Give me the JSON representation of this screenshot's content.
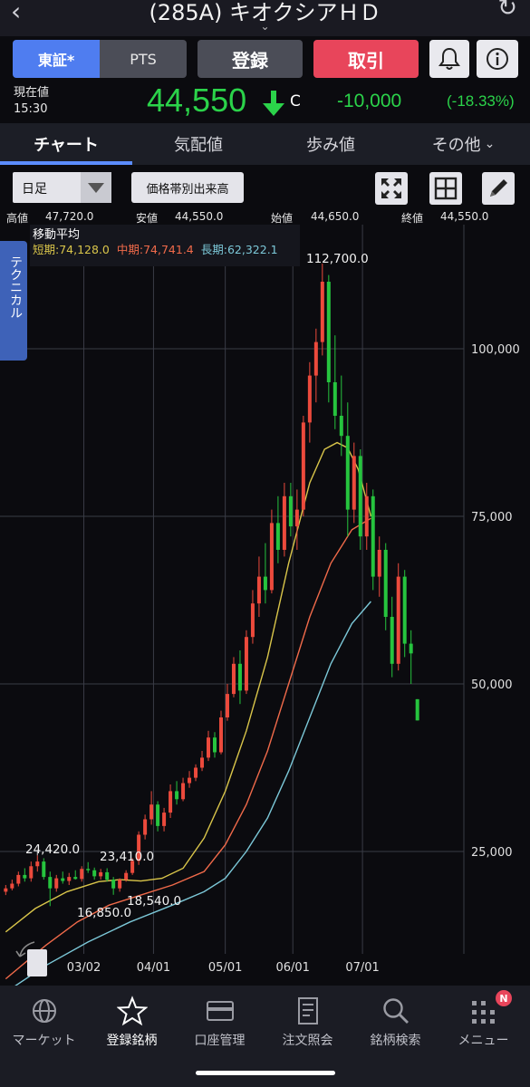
{
  "header": {
    "title": "(285A) キオクシアＨＤ"
  },
  "buttons": {
    "market_tse": "東証*",
    "market_pts": "PTS",
    "register": "登録",
    "trade": "取引"
  },
  "price": {
    "label": "現在値",
    "time": "15:30",
    "value": "44,550",
    "marker": "C",
    "change": "-10,000",
    "change_pct": "(-18.33%)"
  },
  "tabs": [
    {
      "label": "チャート"
    },
    {
      "label": "気配値"
    },
    {
      "label": "歩み値"
    },
    {
      "label": "その他"
    }
  ],
  "toolbar": {
    "period": "日足",
    "vol_by_price": "価格帯別出来高"
  },
  "ohlc": {
    "high_label": "高値",
    "high": "47,720.0",
    "low_label": "安値",
    "low": "44,550.0",
    "open_label": "始値",
    "open": "44,650.0",
    "close_label": "終値",
    "close": "44,550.0"
  },
  "ma": {
    "title": "移動平均",
    "short": "短期:74,128.0",
    "mid": "中期:74,741.4",
    "long": "長期:62,322.1"
  },
  "side_tab": "テクニカル",
  "colors": {
    "up": "#ec4a3c",
    "down": "#26c43e",
    "ma_short": "#d9c54a",
    "ma_mid": "#f06a4a",
    "ma_long": "#7cc8d8",
    "accent": "#4f7df0"
  },
  "chart_data": {
    "type": "candlestick",
    "yticks": [
      "25,000",
      "50,000",
      "75,000",
      "100,000"
    ],
    "ytick_values": [
      25000,
      50000,
      75000,
      100000
    ],
    "xticks": [
      "03/02",
      "04/01",
      "05/01",
      "06/01",
      "07/01"
    ],
    "annotations": [
      {
        "text": "112,700.0",
        "kind": "high"
      },
      {
        "text": "24,420.0",
        "kind": "local_high"
      },
      {
        "text": "23,410.0",
        "kind": "local_high"
      },
      {
        "text": "16,850.0",
        "kind": "local_low"
      },
      {
        "text": "18,540.0",
        "kind": "local_low"
      }
    ],
    "series": [
      {
        "name": "短期",
        "type": "line",
        "points": [
          [
            1,
            13000
          ],
          [
            15,
            16500
          ],
          [
            30,
            19000
          ],
          [
            45,
            20500
          ],
          [
            55,
            20800
          ],
          [
            65,
            20600
          ],
          [
            75,
            21000
          ],
          [
            85,
            22500
          ],
          [
            95,
            27000
          ],
          [
            105,
            34000
          ],
          [
            115,
            43000
          ],
          [
            125,
            54000
          ],
          [
            135,
            68000
          ],
          [
            145,
            80000
          ],
          [
            152,
            85000
          ],
          [
            158,
            86000
          ],
          [
            163,
            85200
          ],
          [
            168,
            82000
          ],
          [
            174,
            75000
          ]
        ]
      },
      {
        "name": "中期",
        "type": "line",
        "points": [
          [
            1,
            6000
          ],
          [
            20,
            11000
          ],
          [
            35,
            14500
          ],
          [
            50,
            17000
          ],
          [
            65,
            18500
          ],
          [
            80,
            20000
          ],
          [
            95,
            22000
          ],
          [
            105,
            26000
          ],
          [
            115,
            32000
          ],
          [
            125,
            40000
          ],
          [
            135,
            50000
          ],
          [
            145,
            60000
          ],
          [
            155,
            68000
          ],
          [
            165,
            73000
          ],
          [
            174,
            74700
          ]
        ]
      },
      {
        "name": "長期",
        "type": "line",
        "points": [
          [
            1,
            4000
          ],
          [
            20,
            8000
          ],
          [
            40,
            11500
          ],
          [
            60,
            14500
          ],
          [
            80,
            17000
          ],
          [
            95,
            19000
          ],
          [
            105,
            21000
          ],
          [
            115,
            25000
          ],
          [
            125,
            30000
          ],
          [
            135,
            37000
          ],
          [
            145,
            45000
          ],
          [
            155,
            53000
          ],
          [
            165,
            59000
          ],
          [
            174,
            62300
          ]
        ]
      }
    ],
    "candles": [
      {
        "i": 1,
        "o": 19000,
        "h": 20000,
        "l": 18500,
        "c": 19500
      },
      {
        "i": 4,
        "o": 19500,
        "h": 20800,
        "l": 19200,
        "c": 20200
      },
      {
        "i": 7,
        "o": 20200,
        "h": 22000,
        "l": 19800,
        "c": 21500
      },
      {
        "i": 10,
        "o": 21500,
        "h": 22500,
        "l": 20500,
        "c": 21000
      },
      {
        "i": 13,
        "o": 21000,
        "h": 23500,
        "l": 20500,
        "c": 22800
      },
      {
        "i": 16,
        "o": 22800,
        "h": 24420,
        "l": 22000,
        "c": 23500
      },
      {
        "i": 19,
        "o": 23500,
        "h": 24000,
        "l": 20800,
        "c": 21200
      },
      {
        "i": 22,
        "o": 21200,
        "h": 22000,
        "l": 16850,
        "c": 19500
      },
      {
        "i": 25,
        "o": 19500,
        "h": 21500,
        "l": 19000,
        "c": 21000
      },
      {
        "i": 28,
        "o": 21000,
        "h": 22000,
        "l": 20200,
        "c": 20600
      },
      {
        "i": 31,
        "o": 20600,
        "h": 21800,
        "l": 20000,
        "c": 21200
      },
      {
        "i": 34,
        "o": 21200,
        "h": 22200,
        "l": 20800,
        "c": 20900
      },
      {
        "i": 37,
        "o": 20900,
        "h": 22800,
        "l": 20500,
        "c": 22400
      },
      {
        "i": 40,
        "o": 22400,
        "h": 23410,
        "l": 21800,
        "c": 22200
      },
      {
        "i": 43,
        "o": 22200,
        "h": 22600,
        "l": 20800,
        "c": 21300
      },
      {
        "i": 46,
        "o": 21300,
        "h": 22400,
        "l": 20800,
        "c": 21900
      },
      {
        "i": 49,
        "o": 21900,
        "h": 22500,
        "l": 20500,
        "c": 20800
      },
      {
        "i": 52,
        "o": 20800,
        "h": 21200,
        "l": 18540,
        "c": 19500
      },
      {
        "i": 55,
        "o": 19500,
        "h": 21000,
        "l": 19000,
        "c": 20800
      },
      {
        "i": 58,
        "o": 20800,
        "h": 22200,
        "l": 20500,
        "c": 21800
      },
      {
        "i": 61,
        "o": 21800,
        "h": 24000,
        "l": 21500,
        "c": 23600
      },
      {
        "i": 64,
        "o": 23600,
        "h": 28000,
        "l": 23000,
        "c": 27500
      },
      {
        "i": 67,
        "o": 27500,
        "h": 30500,
        "l": 26800,
        "c": 29800
      },
      {
        "i": 70,
        "o": 29800,
        "h": 34000,
        "l": 29000,
        "c": 32000
      },
      {
        "i": 73,
        "o": 32000,
        "h": 32500,
        "l": 28000,
        "c": 28800
      },
      {
        "i": 76,
        "o": 28800,
        "h": 31500,
        "l": 28000,
        "c": 30800
      },
      {
        "i": 79,
        "o": 30800,
        "h": 35000,
        "l": 30000,
        "c": 34000
      },
      {
        "i": 82,
        "o": 34000,
        "h": 35500,
        "l": 32000,
        "c": 32800
      },
      {
        "i": 85,
        "o": 32800,
        "h": 36000,
        "l": 32500,
        "c": 35200
      },
      {
        "i": 88,
        "o": 35200,
        "h": 37000,
        "l": 34500,
        "c": 36000
      },
      {
        "i": 91,
        "o": 36000,
        "h": 38000,
        "l": 35500,
        "c": 37500
      },
      {
        "i": 94,
        "o": 37500,
        "h": 40000,
        "l": 37000,
        "c": 39000
      },
      {
        "i": 97,
        "o": 39000,
        "h": 43000,
        "l": 38500,
        "c": 42000
      },
      {
        "i": 100,
        "o": 42000,
        "h": 42800,
        "l": 39000,
        "c": 39800
      },
      {
        "i": 103,
        "o": 39800,
        "h": 46000,
        "l": 39500,
        "c": 45000
      },
      {
        "i": 106,
        "o": 45000,
        "h": 50000,
        "l": 44500,
        "c": 48500
      },
      {
        "i": 109,
        "o": 48500,
        "h": 54000,
        "l": 48000,
        "c": 53000
      },
      {
        "i": 112,
        "o": 53000,
        "h": 55000,
        "l": 47000,
        "c": 49000
      },
      {
        "i": 115,
        "o": 49000,
        "h": 58000,
        "l": 48500,
        "c": 57000
      },
      {
        "i": 118,
        "o": 57000,
        "h": 64000,
        "l": 56000,
        "c": 62000
      },
      {
        "i": 121,
        "o": 62000,
        "h": 69000,
        "l": 60000,
        "c": 66000
      },
      {
        "i": 124,
        "o": 66000,
        "h": 71000,
        "l": 62000,
        "c": 64000
      },
      {
        "i": 127,
        "o": 64000,
        "h": 76000,
        "l": 63500,
        "c": 74000
      },
      {
        "i": 130,
        "o": 74000,
        "h": 78000,
        "l": 68000,
        "c": 70000
      },
      {
        "i": 133,
        "o": 70000,
        "h": 80000,
        "l": 69000,
        "c": 78000
      },
      {
        "i": 136,
        "o": 78000,
        "h": 80000,
        "l": 72000,
        "c": 73500
      },
      {
        "i": 139,
        "o": 73500,
        "h": 79000,
        "l": 70000,
        "c": 76000
      },
      {
        "i": 142,
        "o": 76000,
        "h": 90000,
        "l": 75000,
        "c": 89000
      },
      {
        "i": 145,
        "o": 89000,
        "h": 98000,
        "l": 86000,
        "c": 96000
      },
      {
        "i": 148,
        "o": 96000,
        "h": 103000,
        "l": 92000,
        "c": 101000
      },
      {
        "i": 151,
        "o": 101000,
        "h": 112700,
        "l": 99000,
        "c": 110000
      },
      {
        "i": 154,
        "o": 110000,
        "h": 111000,
        "l": 92000,
        "c": 95000
      },
      {
        "i": 157,
        "o": 95000,
        "h": 102000,
        "l": 88000,
        "c": 90000
      },
      {
        "i": 160,
        "o": 90000,
        "h": 96000,
        "l": 84000,
        "c": 87000
      },
      {
        "i": 163,
        "o": 87000,
        "h": 92000,
        "l": 72000,
        "c": 76000
      },
      {
        "i": 166,
        "o": 76000,
        "h": 86000,
        "l": 74000,
        "c": 84000
      },
      {
        "i": 169,
        "o": 84000,
        "h": 85000,
        "l": 70000,
        "c": 72000
      },
      {
        "i": 172,
        "o": 72000,
        "h": 80000,
        "l": 70000,
        "c": 78000
      },
      {
        "i": 175,
        "o": 78000,
        "h": 79000,
        "l": 64000,
        "c": 66000
      },
      {
        "i": 178,
        "o": 66000,
        "h": 72000,
        "l": 63000,
        "c": 70000
      },
      {
        "i": 181,
        "o": 70000,
        "h": 71000,
        "l": 58000,
        "c": 60000
      },
      {
        "i": 184,
        "o": 60000,
        "h": 63000,
        "l": 51000,
        "c": 53000
      },
      {
        "i": 187,
        "o": 53000,
        "h": 68000,
        "l": 52000,
        "c": 66000
      },
      {
        "i": 190,
        "o": 66000,
        "h": 67000,
        "l": 54000,
        "c": 56000
      },
      {
        "i": 193,
        "o": 56000,
        "h": 58000,
        "l": 50000,
        "c": 54550
      },
      {
        "i": 196,
        "o": 47720,
        "h": 47720,
        "l": 44550,
        "c": 44550
      }
    ]
  },
  "nav": [
    {
      "label": "マーケット",
      "icon": "globe-icon"
    },
    {
      "label": "登録銘柄",
      "icon": "star-icon"
    },
    {
      "label": "口座管理",
      "icon": "card-icon"
    },
    {
      "label": "注文照会",
      "icon": "document-icon"
    },
    {
      "label": "銘柄検索",
      "icon": "search-icon"
    },
    {
      "label": "メニュー",
      "icon": "grid-icon",
      "badge": "N"
    }
  ]
}
